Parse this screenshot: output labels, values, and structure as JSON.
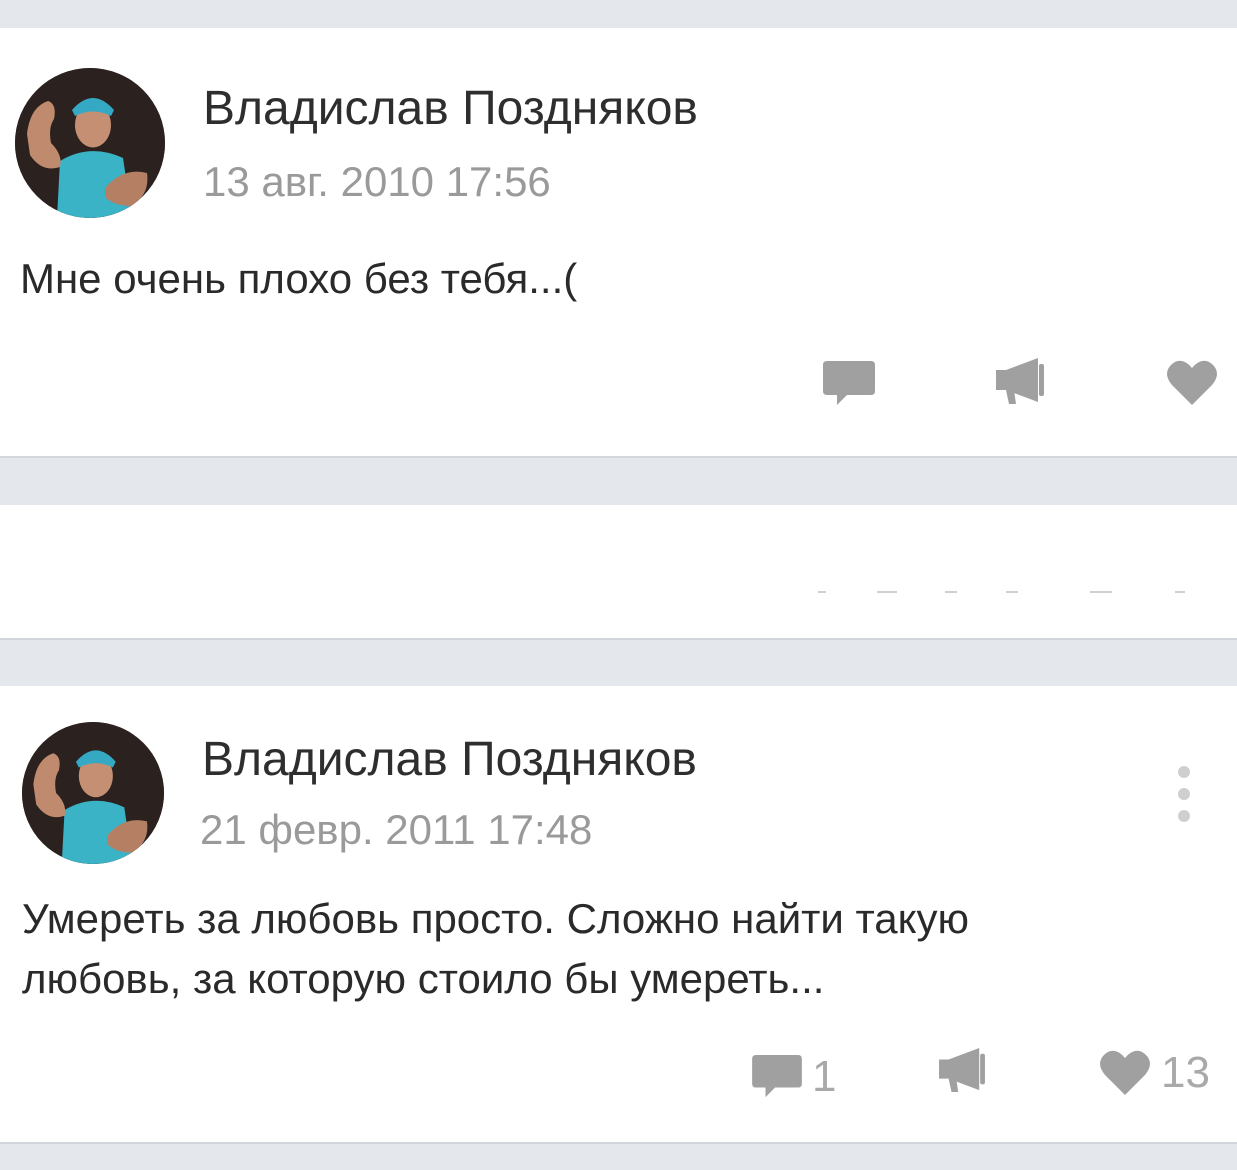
{
  "posts": [
    {
      "author": "Владислав Поздняков",
      "date": "13 авг. 2010 17:56",
      "text_lines": [
        "Мне очень плохо без тебя...("
      ],
      "comments_count": "",
      "likes_count": ""
    },
    {
      "author": "Владислав Поздняков",
      "date": "21 февр. 2011 17:48",
      "text_lines": [
        "Умереть за любовь просто. Сложно найти такую",
        "любовь, за которую стоило бы умереть..."
      ],
      "comments_count": "1",
      "likes_count": "13"
    }
  ],
  "icons": {
    "comment": "comment-icon",
    "share": "share-megaphone-icon",
    "like": "heart-icon",
    "more": "more-vertical-icon"
  },
  "colors": {
    "background": "#e4e7ec",
    "card": "#ffffff",
    "author_text": "#2e2e2e",
    "date_text": "#9a9a9a",
    "action_icon": "#a0a0a0"
  }
}
